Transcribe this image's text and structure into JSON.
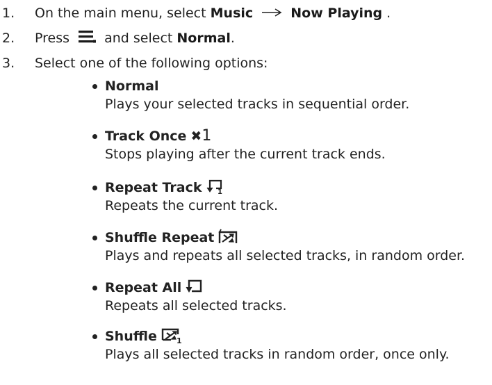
{
  "steps": [
    {
      "number": "1.",
      "before": "On the main menu, select",
      "bold1": "Music",
      "bold2": "Now Playing",
      "after": " ."
    },
    {
      "number": "2.",
      "before": "Press",
      "middle": "and select",
      "bold": "Normal",
      "after": "."
    },
    {
      "number": "3.",
      "text": "Select one of the following options:"
    }
  ],
  "options": [
    {
      "title": "Normal",
      "icon": "",
      "description": "Plays your selected tracks in sequential order."
    },
    {
      "title": "Track Once",
      "icon": "track-once-icon",
      "icon_text": "1",
      "description": "Stops playing after the current track ends."
    },
    {
      "title": "Repeat Track",
      "icon": "repeat-track-icon",
      "icon_text": "1",
      "description": "Repeats the current track."
    },
    {
      "title": "Shuffle Repeat",
      "icon": "shuffle-repeat-icon",
      "description": "Plays and repeats all selected tracks, in random order."
    },
    {
      "title": "Repeat All",
      "icon": "repeat-all-icon",
      "description": "Repeats all selected tracks."
    },
    {
      "title": "Shuffle",
      "icon": "shuffle-icon",
      "icon_text": "1",
      "description": "Plays all selected tracks in random order, once only."
    }
  ],
  "colors": {
    "text": "#222222",
    "background": "#ffffff"
  }
}
